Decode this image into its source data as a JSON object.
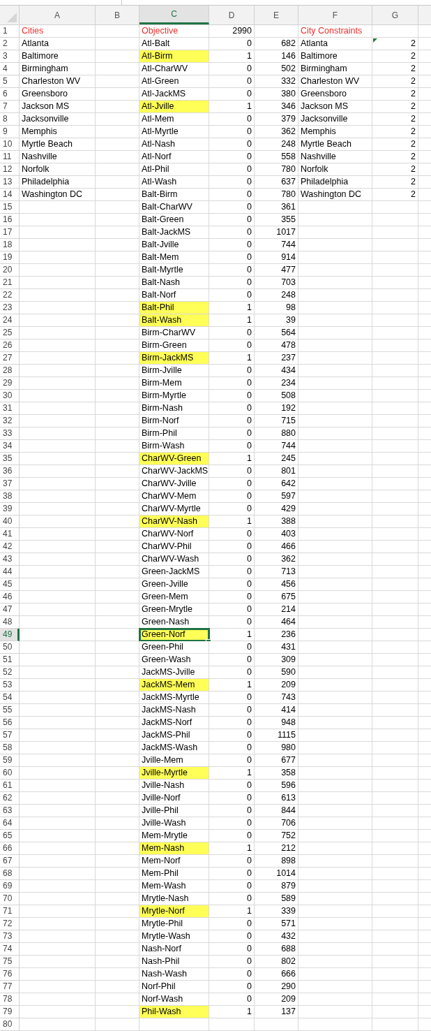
{
  "columns": [
    {
      "label": "A",
      "kind": "text",
      "selected": false
    },
    {
      "label": "B",
      "kind": "text",
      "selected": false
    },
    {
      "label": "C",
      "kind": "text",
      "selected": true
    },
    {
      "label": "D",
      "kind": "number",
      "selected": false
    },
    {
      "label": "E",
      "kind": "number",
      "selected": false
    },
    {
      "label": "F",
      "kind": "text",
      "selected": false
    },
    {
      "label": "G",
      "kind": "number",
      "selected": false
    }
  ],
  "rows": [
    {
      "n": "1",
      "kind": "title",
      "cells": {
        "A": "Cities",
        "C": "Objective",
        "D": "2990",
        "F": "City Constraints"
      },
      "highlighted": false,
      "selected": false,
      "flagged": false
    },
    {
      "n": "2",
      "kind": "data",
      "cells": {
        "A": "Atlanta",
        "C": "Atl-Balt",
        "D": "0",
        "E": "682",
        "F": "Atlanta",
        "G": "2"
      },
      "highlighted": false,
      "selected": false,
      "flagged": true
    },
    {
      "n": "3",
      "kind": "data",
      "cells": {
        "A": "Baltimore",
        "C": "Atl-Birm",
        "D": "1",
        "E": "146",
        "F": "Baltimore",
        "G": "2"
      },
      "highlighted": true,
      "selected": false,
      "flagged": false
    },
    {
      "n": "4",
      "kind": "data",
      "cells": {
        "A": "Birmingham",
        "C": "Atl-CharWV",
        "D": "0",
        "E": "502",
        "F": "Birmingham",
        "G": "2"
      },
      "highlighted": false,
      "selected": false,
      "flagged": false
    },
    {
      "n": "5",
      "kind": "data",
      "cells": {
        "A": "Charleston WV",
        "C": "Atl-Green",
        "D": "0",
        "E": "332",
        "F": "Charleston WV",
        "G": "2"
      },
      "highlighted": false,
      "selected": false,
      "flagged": false
    },
    {
      "n": "6",
      "kind": "data",
      "cells": {
        "A": "Greensboro",
        "C": "Atl-JackMS",
        "D": "0",
        "E": "380",
        "F": "Greensboro",
        "G": "2"
      },
      "highlighted": false,
      "selected": false,
      "flagged": false
    },
    {
      "n": "7",
      "kind": "data",
      "cells": {
        "A": "Jackson MS",
        "C": "Atl-Jville",
        "D": "1",
        "E": "346",
        "F": "Jackson MS",
        "G": "2"
      },
      "highlighted": true,
      "selected": false,
      "flagged": false
    },
    {
      "n": "8",
      "kind": "data",
      "cells": {
        "A": "Jacksonville",
        "C": "Atl-Mem",
        "D": "0",
        "E": "379",
        "F": "Jacksonville",
        "G": "2"
      },
      "highlighted": false,
      "selected": false,
      "flagged": false
    },
    {
      "n": "9",
      "kind": "data",
      "cells": {
        "A": "Memphis",
        "C": "Atl-Myrtle",
        "D": "0",
        "E": "362",
        "F": "Memphis",
        "G": "2"
      },
      "highlighted": false,
      "selected": false,
      "flagged": false
    },
    {
      "n": "10",
      "kind": "data",
      "cells": {
        "A": "Myrtle Beach",
        "C": "Atl-Nash",
        "D": "0",
        "E": "248",
        "F": "Myrtle Beach",
        "G": "2"
      },
      "highlighted": false,
      "selected": false,
      "flagged": false
    },
    {
      "n": "11",
      "kind": "data",
      "cells": {
        "A": "Nashville",
        "C": "Atl-Norf",
        "D": "0",
        "E": "558",
        "F": "Nashville",
        "G": "2"
      },
      "highlighted": false,
      "selected": false,
      "flagged": false
    },
    {
      "n": "12",
      "kind": "data",
      "cells": {
        "A": "Norfolk",
        "C": "Atl-Phil",
        "D": "0",
        "E": "780",
        "F": "Norfolk",
        "G": "2"
      },
      "highlighted": false,
      "selected": false,
      "flagged": false
    },
    {
      "n": "13",
      "kind": "data",
      "cells": {
        "A": "Philadelphia",
        "C": "Atl-Wash",
        "D": "0",
        "E": "637",
        "F": "Philadelphia",
        "G": "2"
      },
      "highlighted": false,
      "selected": false,
      "flagged": false
    },
    {
      "n": "14",
      "kind": "data",
      "cells": {
        "A": "Washington DC",
        "C": "Balt-Birm",
        "D": "0",
        "E": "780",
        "F": "Washington DC",
        "G": "2"
      },
      "highlighted": false,
      "selected": false,
      "flagged": false
    },
    {
      "n": "15",
      "kind": "data",
      "cells": {
        "C": "Balt-CharWV",
        "D": "0",
        "E": "361"
      },
      "highlighted": false,
      "selected": false,
      "flagged": false
    },
    {
      "n": "16",
      "kind": "data",
      "cells": {
        "C": "Balt-Green",
        "D": "0",
        "E": "355"
      },
      "highlighted": false,
      "selected": false,
      "flagged": false
    },
    {
      "n": "17",
      "kind": "data",
      "cells": {
        "C": "Balt-JackMS",
        "D": "0",
        "E": "1017"
      },
      "highlighted": false,
      "selected": false,
      "flagged": false
    },
    {
      "n": "18",
      "kind": "data",
      "cells": {
        "C": "Balt-Jville",
        "D": "0",
        "E": "744"
      },
      "highlighted": false,
      "selected": false,
      "flagged": false
    },
    {
      "n": "19",
      "kind": "data",
      "cells": {
        "C": "Balt-Mem",
        "D": "0",
        "E": "914"
      },
      "highlighted": false,
      "selected": false,
      "flagged": false
    },
    {
      "n": "20",
      "kind": "data",
      "cells": {
        "C": "Balt-Myrtle",
        "D": "0",
        "E": "477"
      },
      "highlighted": false,
      "selected": false,
      "flagged": false
    },
    {
      "n": "21",
      "kind": "data",
      "cells": {
        "C": "Balt-Nash",
        "D": "0",
        "E": "703"
      },
      "highlighted": false,
      "selected": false,
      "flagged": false
    },
    {
      "n": "22",
      "kind": "data",
      "cells": {
        "C": "Balt-Norf",
        "D": "0",
        "E": "248"
      },
      "highlighted": false,
      "selected": false,
      "flagged": false
    },
    {
      "n": "23",
      "kind": "data",
      "cells": {
        "C": "Balt-Phil",
        "D": "1",
        "E": "98"
      },
      "highlighted": true,
      "selected": false,
      "flagged": false
    },
    {
      "n": "24",
      "kind": "data",
      "cells": {
        "C": "Balt-Wash",
        "D": "1",
        "E": "39"
      },
      "highlighted": true,
      "selected": false,
      "flagged": false
    },
    {
      "n": "25",
      "kind": "data",
      "cells": {
        "C": "Birm-CharWV",
        "D": "0",
        "E": "564"
      },
      "highlighted": false,
      "selected": false,
      "flagged": false
    },
    {
      "n": "26",
      "kind": "data",
      "cells": {
        "C": "Birm-Green",
        "D": "0",
        "E": "478"
      },
      "highlighted": false,
      "selected": false,
      "flagged": false
    },
    {
      "n": "27",
      "kind": "data",
      "cells": {
        "C": "Birm-JackMS",
        "D": "1",
        "E": "237"
      },
      "highlighted": true,
      "selected": false,
      "flagged": false
    },
    {
      "n": "28",
      "kind": "data",
      "cells": {
        "C": "Birm-Jville",
        "D": "0",
        "E": "434"
      },
      "highlighted": false,
      "selected": false,
      "flagged": false
    },
    {
      "n": "29",
      "kind": "data",
      "cells": {
        "C": "Birm-Mem",
        "D": "0",
        "E": "234"
      },
      "highlighted": false,
      "selected": false,
      "flagged": false
    },
    {
      "n": "30",
      "kind": "data",
      "cells": {
        "C": "Birm-Myrtle",
        "D": "0",
        "E": "508"
      },
      "highlighted": false,
      "selected": false,
      "flagged": false
    },
    {
      "n": "31",
      "kind": "data",
      "cells": {
        "C": "Birm-Nash",
        "D": "0",
        "E": "192"
      },
      "highlighted": false,
      "selected": false,
      "flagged": false
    },
    {
      "n": "32",
      "kind": "data",
      "cells": {
        "C": "Birm-Norf",
        "D": "0",
        "E": "715"
      },
      "highlighted": false,
      "selected": false,
      "flagged": false
    },
    {
      "n": "33",
      "kind": "data",
      "cells": {
        "C": "Birm-Phil",
        "D": "0",
        "E": "880"
      },
      "highlighted": false,
      "selected": false,
      "flagged": false
    },
    {
      "n": "34",
      "kind": "data",
      "cells": {
        "C": "Birm-Wash",
        "D": "0",
        "E": "744"
      },
      "highlighted": false,
      "selected": false,
      "flagged": false
    },
    {
      "n": "35",
      "kind": "data",
      "cells": {
        "C": "CharWV-Green",
        "D": "1",
        "E": "245"
      },
      "highlighted": true,
      "selected": false,
      "flagged": false
    },
    {
      "n": "36",
      "kind": "data",
      "cells": {
        "C": "CharWV-JackMS",
        "D": "0",
        "E": "801"
      },
      "highlighted": false,
      "selected": false,
      "flagged": false
    },
    {
      "n": "37",
      "kind": "data",
      "cells": {
        "C": "CharWV-Jville",
        "D": "0",
        "E": "642"
      },
      "highlighted": false,
      "selected": false,
      "flagged": false
    },
    {
      "n": "38",
      "kind": "data",
      "cells": {
        "C": "CharWV-Mem",
        "D": "0",
        "E": "597"
      },
      "highlighted": false,
      "selected": false,
      "flagged": false
    },
    {
      "n": "39",
      "kind": "data",
      "cells": {
        "C": "CharWV-Myrtle",
        "D": "0",
        "E": "429"
      },
      "highlighted": false,
      "selected": false,
      "flagged": false
    },
    {
      "n": "40",
      "kind": "data",
      "cells": {
        "C": "CharWV-Nash",
        "D": "1",
        "E": "388"
      },
      "highlighted": true,
      "selected": false,
      "flagged": false
    },
    {
      "n": "41",
      "kind": "data",
      "cells": {
        "C": "CharWV-Norf",
        "D": "0",
        "E": "403"
      },
      "highlighted": false,
      "selected": false,
      "flagged": false
    },
    {
      "n": "42",
      "kind": "data",
      "cells": {
        "C": "CharWV-Phil",
        "D": "0",
        "E": "466"
      },
      "highlighted": false,
      "selected": false,
      "flagged": false
    },
    {
      "n": "43",
      "kind": "data",
      "cells": {
        "C": "CharWV-Wash",
        "D": "0",
        "E": "362"
      },
      "highlighted": false,
      "selected": false,
      "flagged": false
    },
    {
      "n": "44",
      "kind": "data",
      "cells": {
        "C": "Green-JackMS",
        "D": "0",
        "E": "713"
      },
      "highlighted": false,
      "selected": false,
      "flagged": false
    },
    {
      "n": "45",
      "kind": "data",
      "cells": {
        "C": "Green-Jville",
        "D": "0",
        "E": "456"
      },
      "highlighted": false,
      "selected": false,
      "flagged": false
    },
    {
      "n": "46",
      "kind": "data",
      "cells": {
        "C": "Green-Mem",
        "D": "0",
        "E": "675"
      },
      "highlighted": false,
      "selected": false,
      "flagged": false
    },
    {
      "n": "47",
      "kind": "data",
      "cells": {
        "C": "Green-Mrytle",
        "D": "0",
        "E": "214"
      },
      "highlighted": false,
      "selected": false,
      "flagged": false
    },
    {
      "n": "48",
      "kind": "data",
      "cells": {
        "C": "Green-Nash",
        "D": "0",
        "E": "464"
      },
      "highlighted": false,
      "selected": false,
      "flagged": false
    },
    {
      "n": "49",
      "kind": "data",
      "cells": {
        "C": "Green-Norf",
        "D": "1",
        "E": "236"
      },
      "highlighted": true,
      "selected": true,
      "flagged": false
    },
    {
      "n": "50",
      "kind": "data",
      "cells": {
        "C": "Green-Phil",
        "D": "0",
        "E": "431"
      },
      "highlighted": false,
      "selected": false,
      "flagged": false
    },
    {
      "n": "51",
      "kind": "data",
      "cells": {
        "C": "Green-Wash",
        "D": "0",
        "E": "309"
      },
      "highlighted": false,
      "selected": false,
      "flagged": false
    },
    {
      "n": "52",
      "kind": "data",
      "cells": {
        "C": "JackMS-Jville",
        "D": "0",
        "E": "590"
      },
      "highlighted": false,
      "selected": false,
      "flagged": false
    },
    {
      "n": "53",
      "kind": "data",
      "cells": {
        "C": "JackMS-Mem",
        "D": "1",
        "E": "209"
      },
      "highlighted": true,
      "selected": false,
      "flagged": false
    },
    {
      "n": "54",
      "kind": "data",
      "cells": {
        "C": "JackMS-Myrtle",
        "D": "0",
        "E": "743"
      },
      "highlighted": false,
      "selected": false,
      "flagged": false
    },
    {
      "n": "55",
      "kind": "data",
      "cells": {
        "C": "JackMS-Nash",
        "D": "0",
        "E": "414"
      },
      "highlighted": false,
      "selected": false,
      "flagged": false
    },
    {
      "n": "56",
      "kind": "data",
      "cells": {
        "C": "JackMS-Norf",
        "D": "0",
        "E": "948"
      },
      "highlighted": false,
      "selected": false,
      "flagged": false
    },
    {
      "n": "57",
      "kind": "data",
      "cells": {
        "C": "JackMS-Phil",
        "D": "0",
        "E": "1115"
      },
      "highlighted": false,
      "selected": false,
      "flagged": false
    },
    {
      "n": "58",
      "kind": "data",
      "cells": {
        "C": "JackMS-Wash",
        "D": "0",
        "E": "980"
      },
      "highlighted": false,
      "selected": false,
      "flagged": false
    },
    {
      "n": "59",
      "kind": "data",
      "cells": {
        "C": "Jville-Mem",
        "D": "0",
        "E": "677"
      },
      "highlighted": false,
      "selected": false,
      "flagged": false
    },
    {
      "n": "60",
      "kind": "data",
      "cells": {
        "C": "Jville-Myrtle",
        "D": "1",
        "E": "358"
      },
      "highlighted": true,
      "selected": false,
      "flagged": false
    },
    {
      "n": "61",
      "kind": "data",
      "cells": {
        "C": "Jville-Nash",
        "D": "0",
        "E": "596"
      },
      "highlighted": false,
      "selected": false,
      "flagged": false
    },
    {
      "n": "62",
      "kind": "data",
      "cells": {
        "C": "Jville-Norf",
        "D": "0",
        "E": "613"
      },
      "highlighted": false,
      "selected": false,
      "flagged": false
    },
    {
      "n": "63",
      "kind": "data",
      "cells": {
        "C": "Jville-Phil",
        "D": "0",
        "E": "844"
      },
      "highlighted": false,
      "selected": false,
      "flagged": false
    },
    {
      "n": "64",
      "kind": "data",
      "cells": {
        "C": "Jville-Wash",
        "D": "0",
        "E": "706"
      },
      "highlighted": false,
      "selected": false,
      "flagged": false
    },
    {
      "n": "65",
      "kind": "data",
      "cells": {
        "C": "Mem-Mrytle",
        "D": "0",
        "E": "752"
      },
      "highlighted": false,
      "selected": false,
      "flagged": false
    },
    {
      "n": "66",
      "kind": "data",
      "cells": {
        "C": "Mem-Nash",
        "D": "1",
        "E": "212"
      },
      "highlighted": true,
      "selected": false,
      "flagged": false
    },
    {
      "n": "67",
      "kind": "data",
      "cells": {
        "C": "Mem-Norf",
        "D": "0",
        "E": "898"
      },
      "highlighted": false,
      "selected": false,
      "flagged": false
    },
    {
      "n": "68",
      "kind": "data",
      "cells": {
        "C": "Mem-Phil",
        "D": "0",
        "E": "1014"
      },
      "highlighted": false,
      "selected": false,
      "flagged": false
    },
    {
      "n": "69",
      "kind": "data",
      "cells": {
        "C": "Mem-Wash",
        "D": "0",
        "E": "879"
      },
      "highlighted": false,
      "selected": false,
      "flagged": false
    },
    {
      "n": "70",
      "kind": "data",
      "cells": {
        "C": "Mrytle-Nash",
        "D": "0",
        "E": "589"
      },
      "highlighted": false,
      "selected": false,
      "flagged": false
    },
    {
      "n": "71",
      "kind": "data",
      "cells": {
        "C": "Mrytle-Norf",
        "D": "1",
        "E": "339"
      },
      "highlighted": true,
      "selected": false,
      "flagged": false
    },
    {
      "n": "72",
      "kind": "data",
      "cells": {
        "C": "Mrytle-Phil",
        "D": "0",
        "E": "571"
      },
      "highlighted": false,
      "selected": false,
      "flagged": false
    },
    {
      "n": "73",
      "kind": "data",
      "cells": {
        "C": "Mrytle-Wash",
        "D": "0",
        "E": "432"
      },
      "highlighted": false,
      "selected": false,
      "flagged": false
    },
    {
      "n": "74",
      "kind": "data",
      "cells": {
        "C": "Nash-Norf",
        "D": "0",
        "E": "688"
      },
      "highlighted": false,
      "selected": false,
      "flagged": false
    },
    {
      "n": "75",
      "kind": "data",
      "cells": {
        "C": "Nash-Phil",
        "D": "0",
        "E": "802"
      },
      "highlighted": false,
      "selected": false,
      "flagged": false
    },
    {
      "n": "76",
      "kind": "data",
      "cells": {
        "C": "Nash-Wash",
        "D": "0",
        "E": "666"
      },
      "highlighted": false,
      "selected": false,
      "flagged": false
    },
    {
      "n": "77",
      "kind": "data",
      "cells": {
        "C": "Norf-Phil",
        "D": "0",
        "E": "290"
      },
      "highlighted": false,
      "selected": false,
      "flagged": false
    },
    {
      "n": "78",
      "kind": "data",
      "cells": {
        "C": "Norf-Wash",
        "D": "0",
        "E": "209"
      },
      "highlighted": false,
      "selected": false,
      "flagged": false
    },
    {
      "n": "79",
      "kind": "data",
      "cells": {
        "C": "Phil-Wash",
        "D": "1",
        "E": "137"
      },
      "highlighted": true,
      "selected": false,
      "flagged": false
    },
    {
      "n": "80",
      "kind": "data",
      "cells": {},
      "highlighted": false,
      "selected": false,
      "flagged": false
    }
  ]
}
